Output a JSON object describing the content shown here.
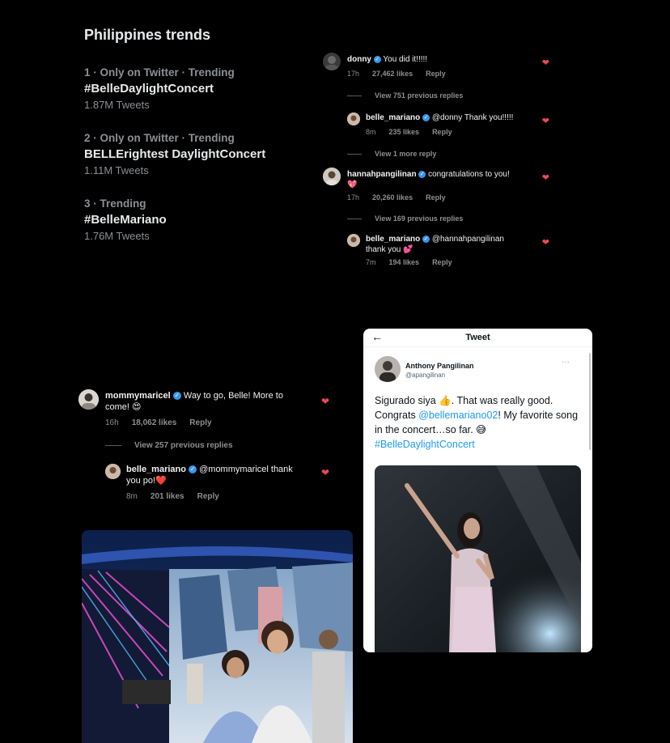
{
  "trends": {
    "title": "Philippines trends",
    "items": [
      {
        "meta": "1 · Only on Twitter · Trending",
        "tag": "#BelleDaylightConcert",
        "count": "1.87M Tweets"
      },
      {
        "meta": "2 · Only on Twitter · Trending",
        "tag": "BELLErightest DaylightConcert",
        "count": "1.11M Tweets"
      },
      {
        "meta": "3 · Trending",
        "tag": "#BelleMariano",
        "count": "1.76M Tweets"
      }
    ]
  },
  "ig_top": {
    "c1": {
      "user": "donny",
      "text": "You did it!!!!!",
      "time": "17h",
      "likes": "27,462 likes",
      "reply": "Reply"
    },
    "v1": "View 751 previous replies",
    "c2": {
      "user": "belle_mariano",
      "text": "@donny Thank you!!!!!",
      "time": "8m",
      "likes": "235 likes",
      "reply": "Reply"
    },
    "v2": "View 1 more reply",
    "c3": {
      "user": "hannahpangilinan",
      "text": "congratulations to you!",
      "emoji": "💖",
      "time": "17h",
      "likes": "20,260 likes",
      "reply": "Reply"
    },
    "v3": "View 169 previous replies",
    "c4": {
      "user": "belle_mariano",
      "text": "@hannahpangilinan",
      "text2": "thank you 💕",
      "time": "7m",
      "likes": "194 likes",
      "reply": "Reply"
    }
  },
  "ig_mid": {
    "c1": {
      "user": "mommymaricel",
      "text": "Way to go, Belle! More to",
      "text2": "come! 😍",
      "time": "16h",
      "likes": "18,062 likes",
      "reply": "Reply"
    },
    "v1": "View 257 previous replies",
    "c2": {
      "user": "belle_mariano",
      "text": "@mommymaricel thank",
      "text2": "you po!❤️",
      "time": "8m",
      "likes": "201 likes",
      "reply": "Reply"
    }
  },
  "tweet": {
    "header": "Tweet",
    "author": "Anthony Pangilinan",
    "handle": "@apangilinan",
    "text_a": "Sigurado siya 👍. That was really good. Congrats ",
    "mention": "@bellemariano02",
    "text_b": "! My favorite song in the concert…so far. 😅",
    "hashtag": "#BelleDaylightConcert"
  },
  "icons": {
    "back": "arrow-left-icon",
    "more": "more-icon",
    "heart": "heart-icon",
    "verified": "verified-badge-icon"
  },
  "colors": {
    "verified": "#3897f0",
    "heart": "#ed4956",
    "link": "#1d9bf0"
  }
}
